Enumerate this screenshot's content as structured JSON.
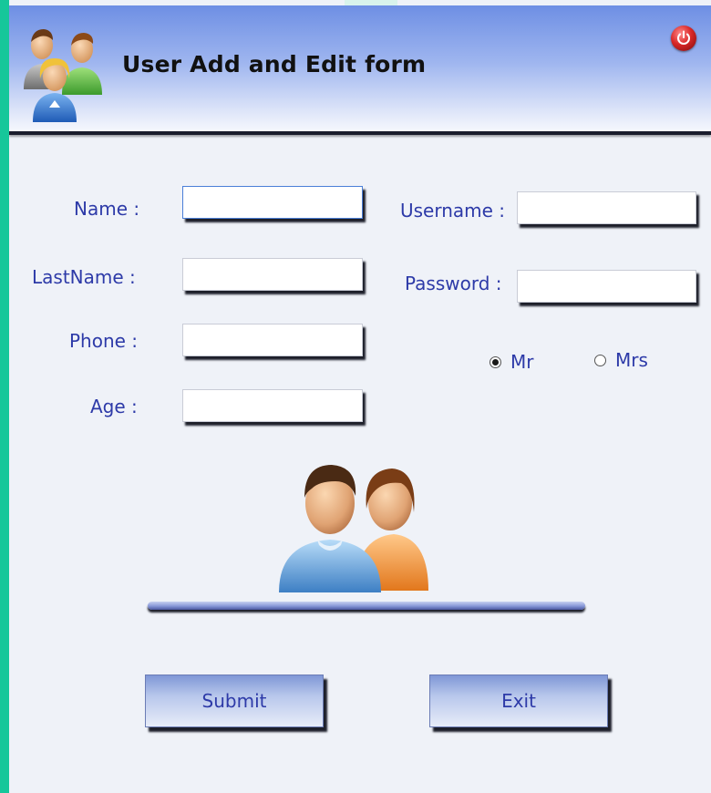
{
  "window": {
    "title": "User Add and Edit form"
  },
  "form": {
    "name_label": "Name :",
    "lastname_label": "LastName :",
    "phone_label": "Phone :",
    "age_label": "Age :",
    "username_label": "Username :",
    "password_label": "Password :",
    "name_value": "",
    "lastname_value": "",
    "phone_value": "",
    "age_value": "",
    "username_value": "",
    "password_value": "",
    "title_options": [
      "Mr",
      "Mrs"
    ],
    "selected_title": "Mr"
  },
  "buttons": {
    "submit": "Submit",
    "exit": "Exit"
  },
  "icons": {
    "header": "users-group-icon",
    "power": "power-icon",
    "center": "couple-users-icon"
  },
  "colors": {
    "label": "#2d3aa8",
    "frame": "#16c79a",
    "panel": "#eff2f8"
  }
}
